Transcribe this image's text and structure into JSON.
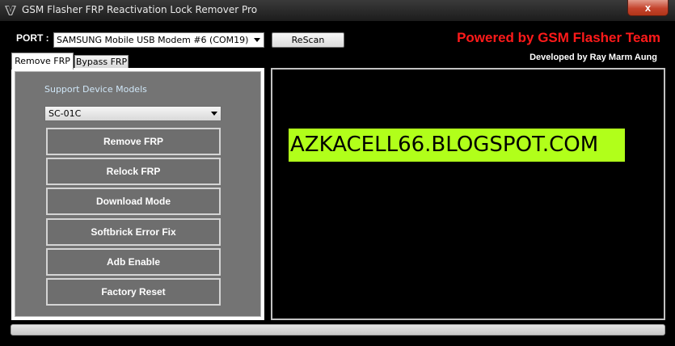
{
  "window": {
    "title": "GSM Flasher FRP Reactivation Lock Remover Pro",
    "close_label": "x"
  },
  "header": {
    "port_label": "PORT :",
    "port_value": "SAMSUNG Mobile USB Modem #6 (COM19)",
    "rescan_label": "ReScan",
    "powered_by": "Powered by GSM Flasher Team",
    "developed_by": "Developed by Ray Marm Aung"
  },
  "tabs": [
    {
      "label": "Remove FRP",
      "active": true
    },
    {
      "label": "Bypass FRP",
      "active": false
    }
  ],
  "panel": {
    "support_label": "Support Device Models",
    "model_value": "SC-01C",
    "buttons": [
      "Remove FRP",
      "Relock FRP",
      "Download Mode",
      "Softbrick Error Fix",
      "Adb Enable",
      "Factory Reset"
    ]
  },
  "console": {
    "watermark": "AZKACELL66.BLOGSPOT.COM"
  },
  "progress": {
    "value_percent": 0
  },
  "colors": {
    "powered_red": "#ff1a1a",
    "watermark_green": "#b1ff1a",
    "panel_gray": "#747474"
  }
}
